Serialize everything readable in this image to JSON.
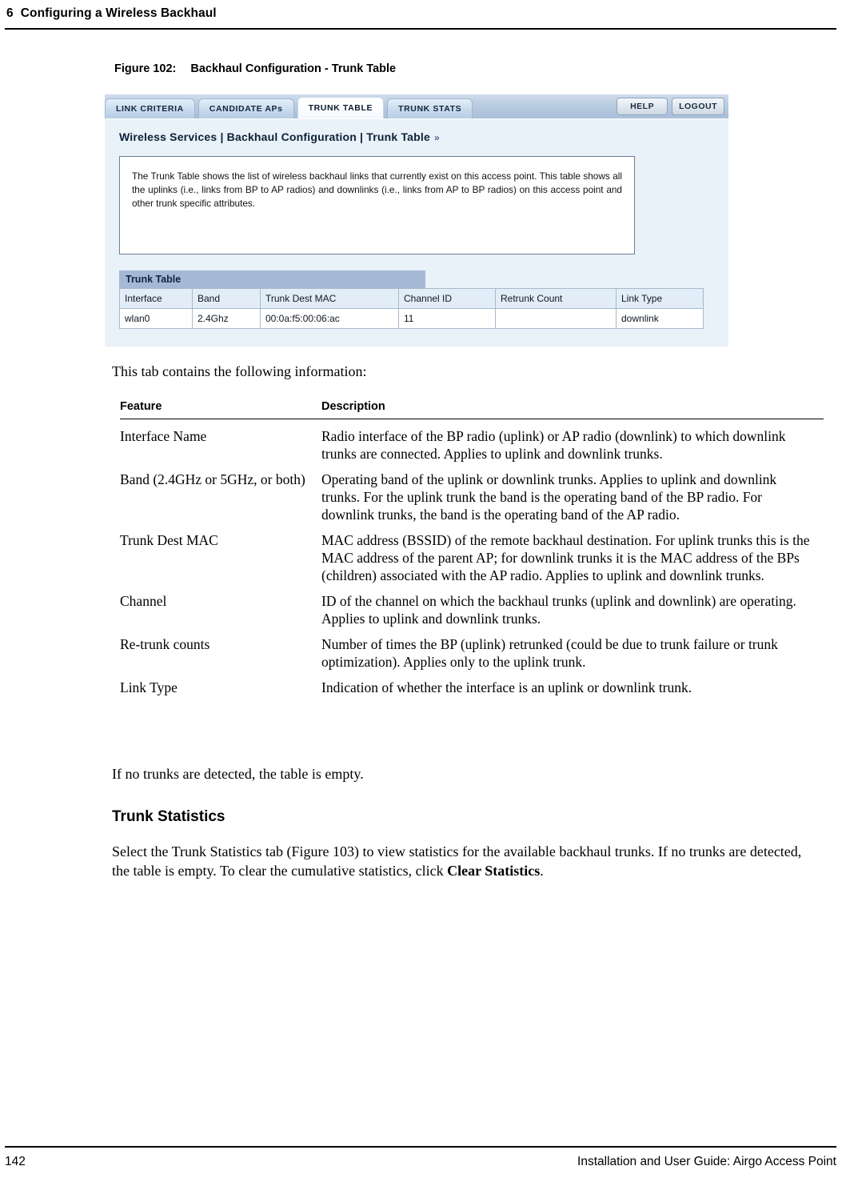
{
  "page_header": {
    "chapter_number": "6",
    "chapter_title": "Configuring a Wireless Backhaul"
  },
  "figure": {
    "label": "Figure 102:",
    "title": "Backhaul Configuration - Trunk Table"
  },
  "screenshot": {
    "tabs": [
      {
        "label": "LINK CRITERIA",
        "active": false
      },
      {
        "label": "CANDIDATE APs",
        "active": false
      },
      {
        "label": "TRUNK TABLE",
        "active": true
      },
      {
        "label": "TRUNK STATS",
        "active": false
      }
    ],
    "actions": {
      "help_label": "HELP",
      "logout_label": "LOGOUT"
    },
    "breadcrumb": {
      "text": "Wireless Services | Backhaul Configuration | Trunk Table",
      "chevron": "»"
    },
    "info_text": "The Trunk Table shows the list of wireless backhaul links that currently exist on this access point. This table shows all the uplinks (i.e., links from BP to AP radios) and downlinks (i.e., links from AP to BP radios) on this access point and other trunk specific attributes.",
    "trunk_table": {
      "title": "Trunk Table",
      "columns": [
        "Interface",
        "Band",
        "Trunk Dest MAC",
        "Channel ID",
        "Retrunk Count",
        "Link Type"
      ],
      "rows": [
        {
          "interface": "wlan0",
          "band": "2.4Ghz",
          "trunk_dest_mac": "00:0a:f5:00:06:ac",
          "channel_id": "11",
          "retrunk_count": "",
          "link_type": "downlink"
        }
      ]
    },
    "colors": {
      "panel_background": "#e9f1f9",
      "tabbar_gradient_top": "#cfdcec",
      "tabbar_gradient_bottom": "#a9bfd8",
      "table_title_bar": "#a5b9d5",
      "table_header_cell": "#e3edf7",
      "table_border": "#a8b9cd"
    }
  },
  "body": {
    "intro_line": "This tab contains the following information:",
    "feature_table": {
      "header_feature": "Feature",
      "header_description": "Description",
      "rows": [
        {
          "feature": "Interface Name",
          "description": "Radio interface of the BP radio (uplink) or AP radio (downlink) to which downlink trunks are connected. Applies to uplink and downlink trunks."
        },
        {
          "feature": "Band (2.4GHz or 5GHz, or both)",
          "description": "Operating band of the uplink or downlink trunks. Applies to uplink and downlink trunks. For the uplink trunk the band is the operating band of the BP radio. For downlink trunks, the band is the operating band of the AP radio."
        },
        {
          "feature": "Trunk Dest MAC",
          "description": "MAC address (BSSID) of the remote backhaul destination. For uplink trunks this is the MAC address of the parent AP; for downlink trunks it is the MAC address of the BPs (children) associated with the AP radio. Applies to uplink and downlink trunks."
        },
        {
          "feature": "Channel",
          "description": "ID of the channel on which the backhaul trunks (uplink and downlink) are operating. Applies to uplink and downlink trunks."
        },
        {
          "feature": "Re-trunk counts",
          "description": "Number of times the BP (uplink) retrunked (could be due to trunk failure or trunk optimization). Applies only to the uplink trunk."
        },
        {
          "feature": "Link Type",
          "description": "Indication of whether the interface is an uplink or downlink trunk."
        }
      ]
    },
    "no_trunks_line": "If no trunks are detected, the table is empty.",
    "trunk_statistics_heading": "Trunk Statistics",
    "trunk_statistics_paragraph_part1": "Select the Trunk Statistics tab (Figure 103) to view statistics for the available backhaul trunks. If no trunks are detected, the table is empty. To clear the cumulative statistics, click ",
    "trunk_statistics_paragraph_bold": "Clear Statistics",
    "trunk_statistics_paragraph_part2": "."
  },
  "footer": {
    "page_number": "142",
    "guide_title": "Installation and User Guide: Airgo Access Point"
  }
}
